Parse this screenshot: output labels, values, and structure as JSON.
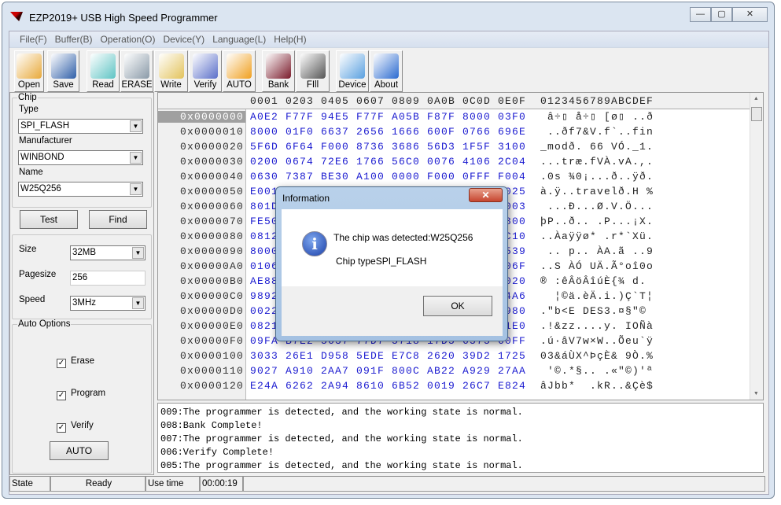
{
  "window": {
    "title": "EZP2019+ USB High Speed Programmer",
    "minimize": "—",
    "maximize": "▢",
    "close": "✕"
  },
  "menu": [
    "File(F)",
    "Buffer(B)",
    "Operation(O)",
    "Device(Y)",
    "Language(L)",
    "Help(H)"
  ],
  "toolbar": [
    {
      "label": "Open",
      "icon": "folder-open-icon",
      "color": "#e8a93a"
    },
    {
      "label": "Save",
      "icon": "floppy-disk-icon",
      "color": "#2f5fa8"
    },
    {
      "label": "Read",
      "icon": "notepad-icon",
      "color": "#5fc4c4"
    },
    {
      "label": "ERASE",
      "icon": "erase-cylinder-icon",
      "color": "#8a9aa8"
    },
    {
      "label": "Write",
      "icon": "folder-download-icon",
      "color": "#e3c35c"
    },
    {
      "label": "Verify",
      "icon": "magnifier-verify-icon",
      "color": "#5b6fc9"
    },
    {
      "label": "AUTO",
      "icon": "running-man-icon",
      "color": "#f0a020"
    },
    {
      "label": "Bank",
      "icon": "chip-info-icon",
      "color": "#7a1a2a"
    },
    {
      "label": "FIll",
      "icon": "fill-bin-icon",
      "color": "#555555"
    },
    {
      "label": "Device",
      "icon": "device-gear-icon",
      "color": "#5aa0e0"
    },
    {
      "label": "About",
      "icon": "help-question-icon",
      "color": "#2a6ad0"
    }
  ],
  "chip": {
    "group": "Chip",
    "type_label": "Type",
    "type": "SPI_FLASH",
    "manufacturer_label": "Manufacturer",
    "manufacturer": "WINBOND",
    "name_label": "Name",
    "name": "W25Q256",
    "test": "Test",
    "find": "Find"
  },
  "params": {
    "size_label": "Size",
    "size": "32MB",
    "pagesize_label": "Pagesize",
    "pagesize": "256",
    "speed_label": "Speed",
    "speed": "3MHz"
  },
  "auto_options": {
    "group": "Auto Options",
    "erase": "Erase",
    "program": "Program",
    "verify": "Verify",
    "check": "✓",
    "button": "AUTO"
  },
  "hex": {
    "header_hex": "0001 0203 0405 0607 0809 0A0B 0C0D 0E0F",
    "header_ascii": "0123456789ABCDEF",
    "rows": [
      {
        "addr": "0x0000000",
        "hex": "A0E2 F77F 94E5 F77F A05B F87F 8000 03F0",
        "ascii": " â÷▯ å÷▯ [ø▯ ..ð"
      },
      {
        "addr": "0x0000010",
        "hex": "8000 01F0 6637 2656 1666 600F 0766 696E",
        "ascii": " ..ðf7&V.f`..fin"
      },
      {
        "addr": "0x0000020",
        "hex": "5F6D 6F64 F000 8736 3686 56D3 1F5F 3100",
        "ascii": "_modð. 66 VÓ._1."
      },
      {
        "addr": "0x0000030",
        "hex": "0200 0674 72E6 1766 56C0 0076 4106 2C04",
        "ascii": "...træ.fVÀ.vA.,."
      },
      {
        "addr": "0x0000040",
        "hex": "0630 7387 BE30 A100 0000 F000 0FFF F004",
        "ascii": ".0s ¾0¡...ð..ÿð."
      },
      {
        "addr": "0x0000050",
        "hex": "E001                               0025",
        "ascii": "à.ÿ..travelð.H %"
      },
      {
        "addr": "0x0000060",
        "hex": "801D                               0003",
        "ascii": " ...Ð...Ø.V.Ö..."
      },
      {
        "addr": "0x0000070",
        "hex": "FE50                               0800",
        "ascii": "þP..ð.. .P...¡X."
      },
      {
        "addr": "0x0000080",
        "hex": "0812                               0C10",
        "ascii": "..Àaÿÿø* .r*`Xü."
      },
      {
        "addr": "0x0000090",
        "hex": "8000                               0539",
        "ascii": " .. p.. ÀA.ã ..9"
      },
      {
        "addr": "0x00000A0",
        "hex": "0106                               006F",
        "ascii": "..S ÀÓ UÄ.Ã°oî0o"
      },
      {
        "addr": "0x00000B0",
        "hex": "AE88                               0020",
        "ascii": "® :êÂöÂîúÈ{¾ d."
      },
      {
        "addr": "0x00000C0",
        "hex": "9892                               04A6",
        "ascii": "  ¦©ä.èÄ.i.)Ç`T¦"
      },
      {
        "addr": "0x00000D0",
        "hex": "0022                               0980",
        "ascii": ".\"b<E DES3.¤§\"©"
      },
      {
        "addr": "0x00000E0",
        "hex": "0821                               01E0",
        "ascii": ".!&zz....y. IOÑà"
      },
      {
        "addr": "0x00000F0",
        "hex": "09FA B7E2 5637 77D7 5718 17D5 6575 60FF",
        "ascii": ".ú·âV7w×W..Õeu`ÿ"
      },
      {
        "addr": "0x0000100",
        "hex": "3033 26E1 D958 5EDE E7C8 2620 39D2 1725",
        "ascii": "03&áÙX^ÞçÈ& 9Ò.%"
      },
      {
        "addr": "0x0000110",
        "hex": "9027 A910 2AA7 091F 800C AB22 A929 27AA",
        "ascii": " '©.*§.. .«\"©)'ª"
      },
      {
        "addr": "0x0000120",
        "hex": "E24A 6262 2A94 8610 6B52 0019 26C7 E824",
        "ascii": "âJbb*  .kR..&Çè$"
      }
    ]
  },
  "log": [
    "009:The programmer is detected, and the working state is normal.",
    "008:Bank Complete!",
    "007:The programmer is detected, and the working state is normal.",
    "006:Verify Complete!",
    "005:The programmer is detected, and the working state is normal."
  ],
  "status": {
    "state_label": "State",
    "state": "Ready",
    "time_label": "Use time",
    "time": "00:00:19"
  },
  "dialog": {
    "title": "Information",
    "close": "✕",
    "icon": "i",
    "line1": "The chip was detected:W25Q256",
    "line2": "Chip typeSPI_FLASH",
    "ok": "OK"
  }
}
